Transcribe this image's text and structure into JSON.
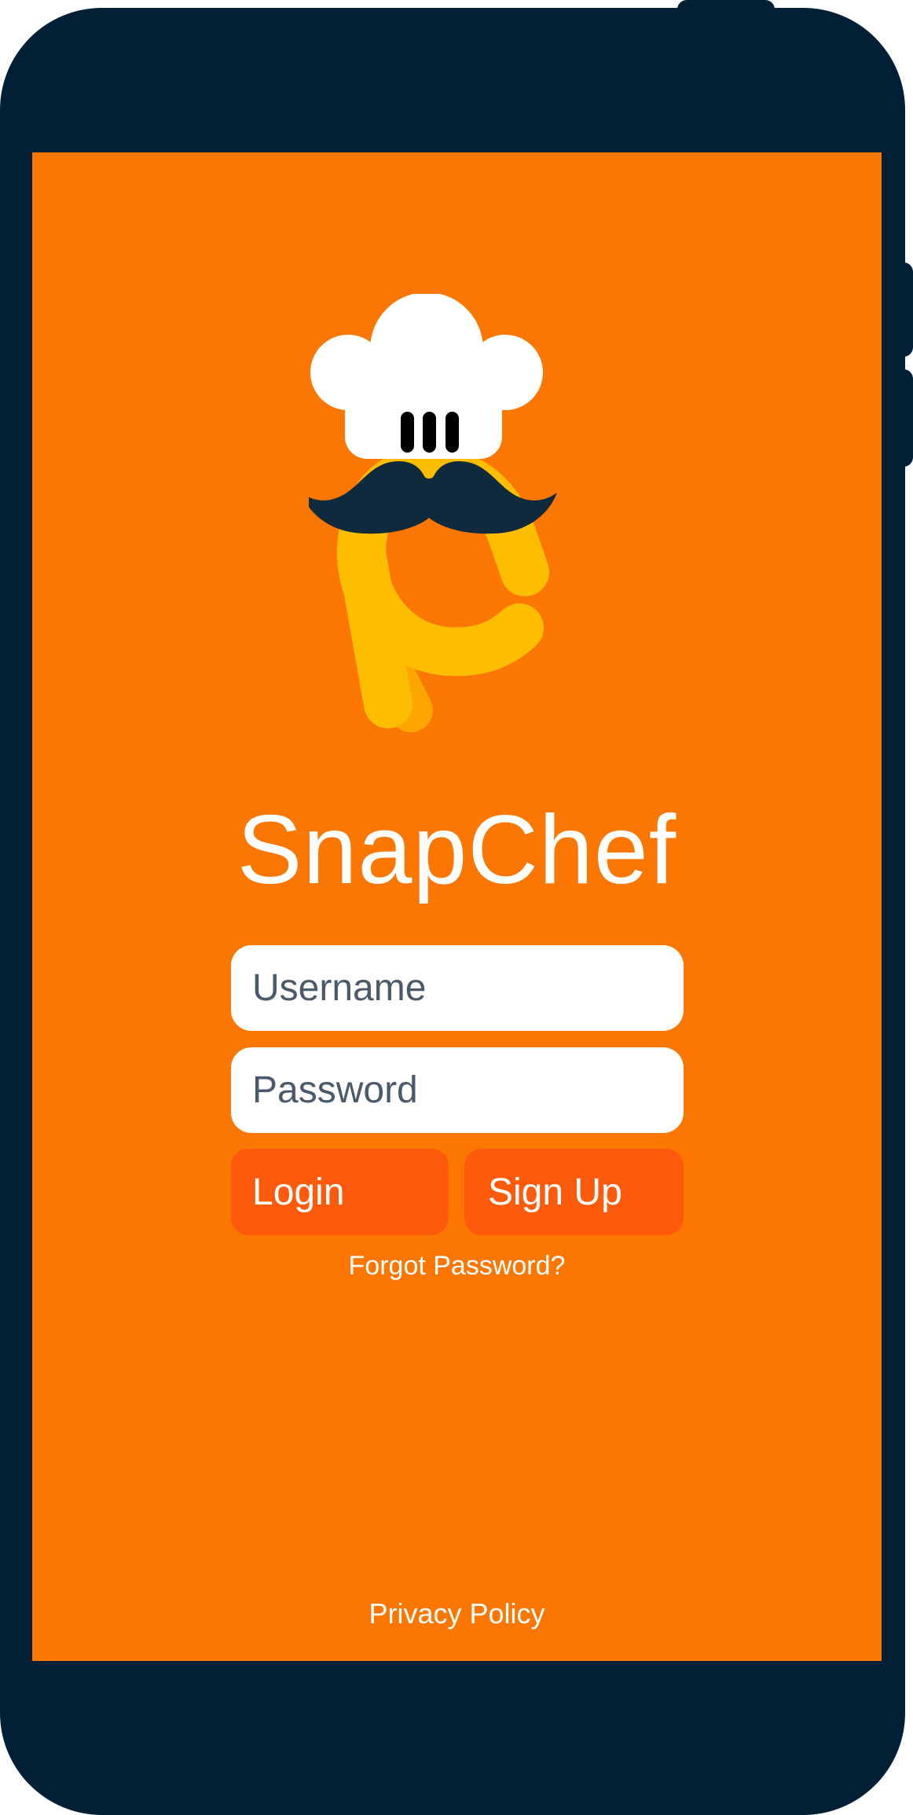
{
  "app": {
    "title": "SnapChef",
    "logo_icon": "chef-mascot-icon"
  },
  "login_form": {
    "username_placeholder": "Username",
    "password_placeholder": "Password",
    "login_label": "Login",
    "signup_label": "Sign Up",
    "forgot_password_label": "Forgot Password?"
  },
  "footer": {
    "privacy_label": "Privacy Policy"
  },
  "colors": {
    "device_frame": "#012036",
    "screen_background": "#fc7701",
    "button_background": "#fd5b0b",
    "logo_yellow": "#fdbd00",
    "logo_yellow_dark": "#fda600",
    "mustache": "#0f2a3d",
    "chef_hat": "#ffffff",
    "text_light": "#ffffff",
    "placeholder_text": "#4a5a6a"
  }
}
